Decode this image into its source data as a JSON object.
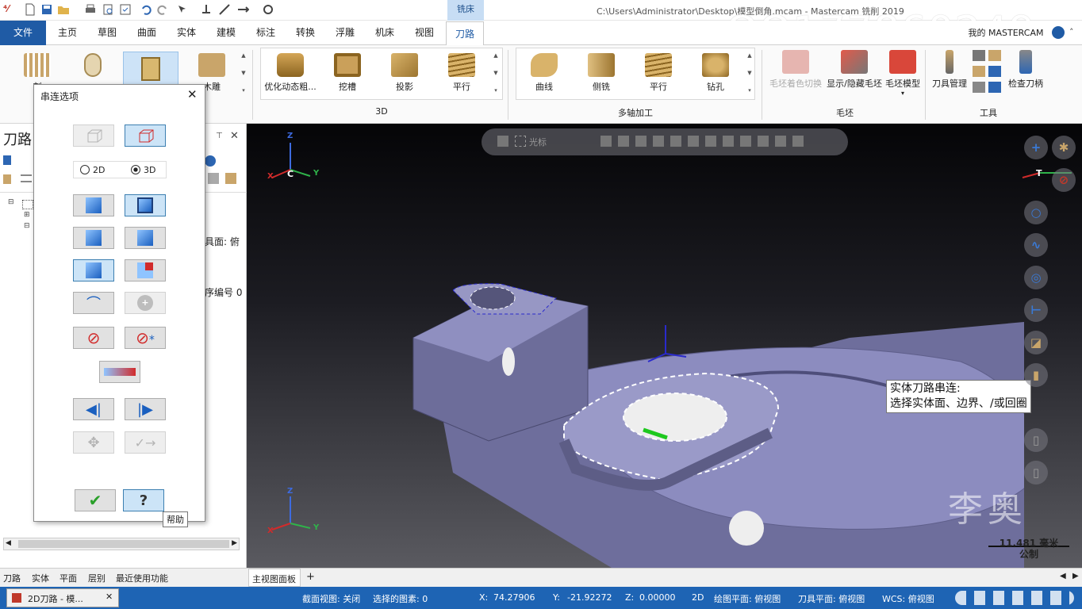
{
  "titlebar": {
    "context_tab": "铣床",
    "title": "C:\\Users\\Administrator\\Desktop\\模型倒角.mcam - Mastercam 铣削 2019",
    "watermark": "QQ177860249"
  },
  "tabs": [
    {
      "label": "文件"
    },
    {
      "label": "主页"
    },
    {
      "label": "草图"
    },
    {
      "label": "曲面"
    },
    {
      "label": "实体"
    },
    {
      "label": "建模"
    },
    {
      "label": "标注"
    },
    {
      "label": "转换"
    },
    {
      "label": "浮雕"
    },
    {
      "label": "机床"
    },
    {
      "label": "视图"
    },
    {
      "label": "刀路"
    }
  ],
  "account": "我的 MASTERCAM",
  "ribbon": {
    "group2d_partial": [
      "刻",
      "",
      "",
      "",
      ""
    ],
    "group2d_last": "木雕",
    "group3d": {
      "label": "3D",
      "items": [
        "优化动态粗...",
        "挖槽",
        "投影",
        "平行"
      ]
    },
    "multi": {
      "label": "多轴加工",
      "items": [
        "曲线",
        "侧铣",
        "平行",
        "钻孔"
      ]
    },
    "stock": {
      "label": "毛坯",
      "items": [
        "毛坯着色切换",
        "显示/隐藏毛坯",
        "毛坯模型"
      ]
    },
    "tools": {
      "label": "工具",
      "items": [
        "刀具管理",
        "检查刀柄"
      ]
    }
  },
  "leftpane": {
    "title": "刀路",
    "snippet1": "具面: 俯",
    "snippet2": "序编号 0"
  },
  "dialog": {
    "title": "串连选项",
    "radio_2d": "2D",
    "radio_3d": "3D",
    "help_tooltip": "帮助"
  },
  "viewport": {
    "toolbar_label": "光标",
    "tooltip_line1": "实体刀路串连:",
    "tooltip_line2": "选择实体面、边界、/或回圈",
    "scale_value": "11.481 毫米",
    "scale_unit": "公制",
    "axis_labels": {
      "z": "Z",
      "x": "X",
      "y": "Y",
      "c": "C",
      "t": "T"
    },
    "side_watermark": "李奥"
  },
  "bottomtabs": [
    "刀路",
    "实体",
    "平面",
    "层别",
    "最近使用功能"
  ],
  "viewtab": "主视图面板",
  "status": {
    "task": "2D刀路 - 模...",
    "section": "截面视图: 关闭",
    "selected": "选择的图素: 0",
    "x_label": "X:",
    "x": "74.27906",
    "y_label": "Y:",
    "y": "-21.92272",
    "z_label": "Z:",
    "z": "0.00000",
    "mode": "2D",
    "plane": "绘图平面: 俯视图",
    "toolplane": "刀具平面: 俯视图",
    "wcs": "WCS: 俯视图"
  },
  "colors": {
    "accent": "#1f5ba5",
    "status": "#1e64b4",
    "part": "#7f7fb0"
  }
}
